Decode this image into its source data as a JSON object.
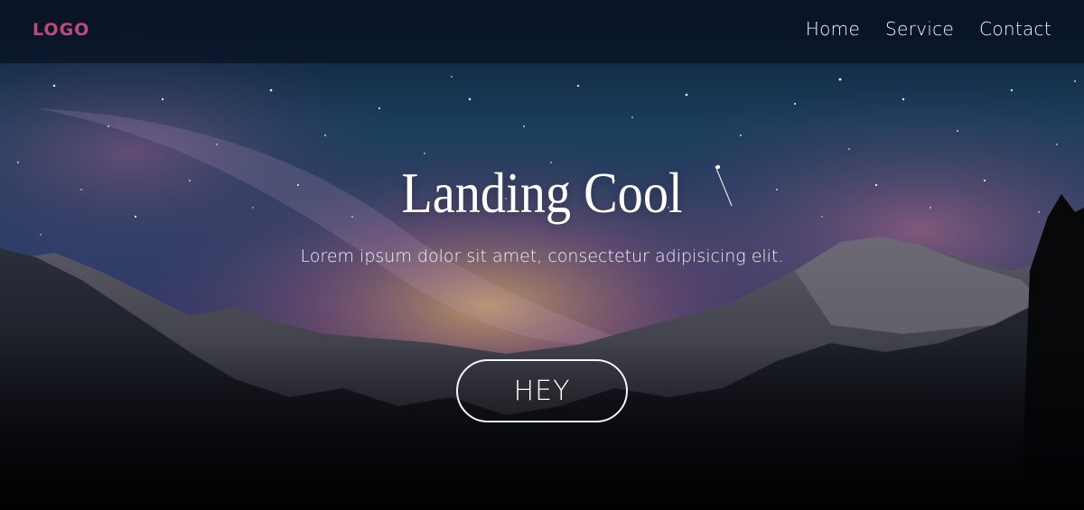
{
  "header": {
    "logo_text": "LOGO",
    "nav": [
      {
        "label": "Home"
      },
      {
        "label": "Service"
      },
      {
        "label": "Contact"
      }
    ]
  },
  "hero": {
    "title": "Landing Cool",
    "subtitle": "Lorem ipsum dolor sit amet, consectetur adipisicing elit.",
    "button_label": "HEY"
  },
  "colors": {
    "logo": "#c04a7d",
    "nav_text": "#f4f6fb",
    "button_border": "#f4f6fb"
  }
}
